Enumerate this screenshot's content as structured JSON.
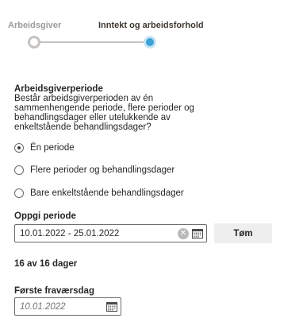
{
  "stepper": {
    "steps": [
      {
        "label": "Arbeidsgiver",
        "state": "completed"
      },
      {
        "label": "Inntekt og arbeidsforhold",
        "state": "active"
      }
    ],
    "colors": {
      "active": "#3ba3d6",
      "inactive": "#c6c2bf"
    }
  },
  "period_section": {
    "title": "Arbeidsgiverperiode",
    "description_lines": [
      "Består arbeidsgiverperioden av én",
      "sammenhengende periode, flere perioder og",
      "behandlingsdager eller utelukkende av",
      "enkeltstående behandlingsdager?"
    ],
    "options": [
      {
        "label": "Én periode",
        "checked": true
      },
      {
        "label": "Flere perioder og behandlingsdager",
        "checked": false
      },
      {
        "label": "Bare enkeltstående behandlingsdager",
        "checked": false
      }
    ]
  },
  "period_input": {
    "label": "Oppgi periode",
    "value": "10.01.2022 - 25.01.2022",
    "clear_button_label": "Tøm"
  },
  "days_summary": "16 av 16 dager",
  "first_absence": {
    "label": "Første fraværsdag",
    "placeholder": "10.01.2022"
  },
  "icons": {
    "clear": "clear-x-icon",
    "calendar": "calendar-icon"
  }
}
